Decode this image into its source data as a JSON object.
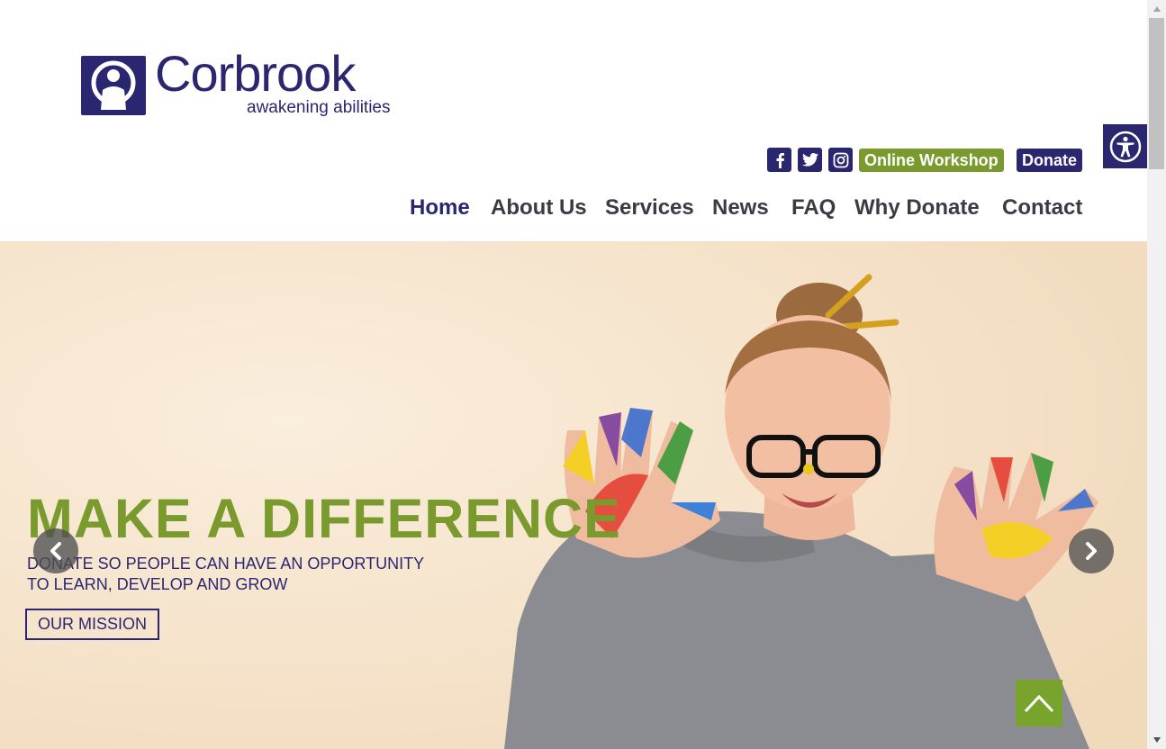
{
  "brand": {
    "name": "Corbrook",
    "tagline": "awakening abilities",
    "color": "#2b2670"
  },
  "social": [
    {
      "icon": "facebook-icon",
      "glyph": "f"
    },
    {
      "icon": "twitter-icon",
      "glyph": ""
    },
    {
      "icon": "instagram-icon",
      "glyph": ""
    }
  ],
  "header_buttons": {
    "online_workshop": "Online Workshop",
    "donate": "Donate"
  },
  "nav": [
    "Home",
    "About Us",
    "Services",
    "News",
    "FAQ",
    "Why Donate",
    "Contact"
  ],
  "nav_active": "Home",
  "hero": {
    "title": "MAKE A DIFFERENCE",
    "subtitle_line1": "DONATE SO PEOPLE CAN HAVE AN OPPORTUNITY",
    "subtitle_line2": "TO LEARN, DEVELOP AND GROW",
    "cta": "OUR MISSION",
    "accent_color": "#7a9a2e"
  },
  "icons": {
    "accessibility": "accessibility-icon",
    "prev": "chevron-left-icon",
    "next": "chevron-right-icon",
    "back_to_top": "chevron-up-icon"
  }
}
